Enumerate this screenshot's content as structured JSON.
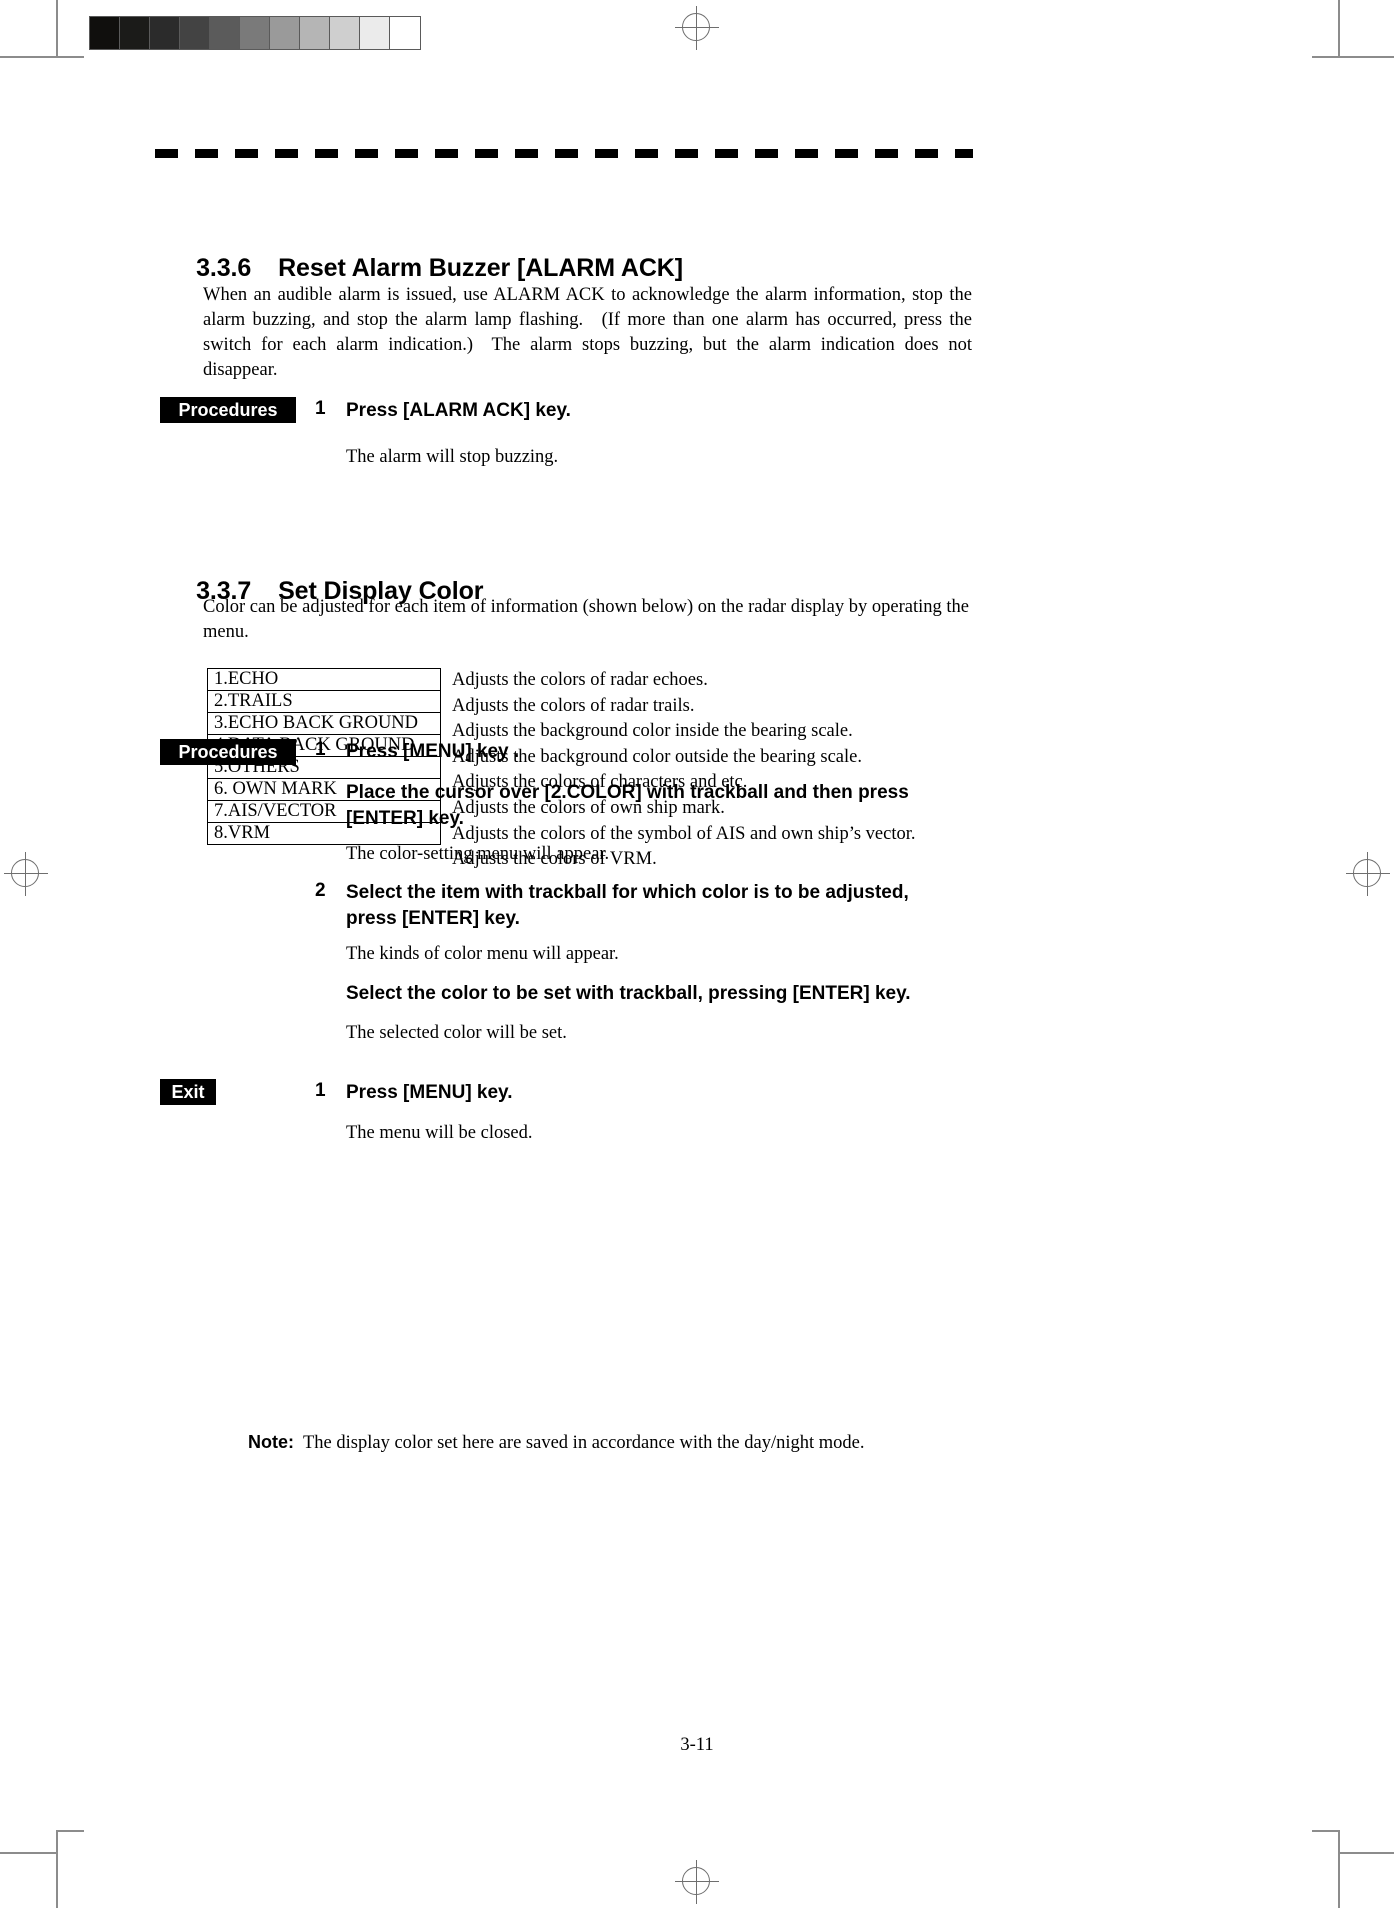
{
  "page": {
    "folio": "3-11"
  },
  "calibration": {
    "swatches": [
      "#100f0d",
      "#1b1b19",
      "#2b2b2b",
      "#434343",
      "#5b5b5b",
      "#7a7a7a",
      "#9a9a9a",
      "#b5b5b5",
      "#cfcfcf",
      "#ebebeb",
      "#ffffff"
    ]
  },
  "sections": {
    "alarm_ack": {
      "number": "3.3.6",
      "title": "Reset Alarm Buzzer [ALARM ACK]",
      "body": "When an audible alarm is issued, use ALARM ACK to acknowledge the alarm information, stop the alarm buzzing, and stop the alarm lamp flashing. (If more than one alarm has occurred, press the switch for each alarm indication.) The alarm stops buzzing, but the alarm indication does not disappear.",
      "procedures_label": "Procedures",
      "step1_num": "1",
      "step1_text": "Press [ALARM ACK] key.",
      "step1_result": "The alarm will stop buzzing."
    },
    "display_color": {
      "number": "3.3.7",
      "title": "Set Display Color",
      "body": "Color can be adjusted for each item of information (shown below) on the radar display by operating the menu.",
      "menu_items": [
        {
          "name": "1.ECHO",
          "description": "Adjusts the colors of radar echoes."
        },
        {
          "name": "2.TRAILS",
          "description": "Adjusts the colors of radar trails."
        },
        {
          "name": "3.ECHO BACK GROUND",
          "description": "Adjusts the background color inside the bearing scale."
        },
        {
          "name": "4.DATA BACK GROUND",
          "description": "Adjusts the background color outside the bearing scale."
        },
        {
          "name": "5.OTHERS",
          "description": "Adjusts the colors of characters and etc."
        },
        {
          "name": "6. OWN MARK",
          "description": "Adjusts the colors of own ship mark."
        },
        {
          "name": "7.AIS/VECTOR",
          "description": "Adjusts the colors of the symbol of AIS and own ship’s vector."
        },
        {
          "name": "8.VRM",
          "description": "Adjusts the colors of VRM."
        }
      ],
      "procedures_label": "Procedures",
      "step1_num": "1",
      "step1_text": "Press [MENU] key .",
      "step1b_text": "Place the cursor over [2.COLOR] with trackball and then press [ENTER] key.",
      "step1_result": "The color-setting menu will appear.",
      "step2_num": "2",
      "step2_text": "Select the item with trackball for which color is to be adjusted, press [ENTER] key.",
      "step2_result": "The kinds of color menu will appear.",
      "step2b_text": "Select the color to be set with trackball, pressing [ENTER] key.",
      "step2b_result": "The selected color will be set.",
      "exit_label": "Exit",
      "exit_step_num": "1",
      "exit_step_text": "Press [MENU] key.",
      "exit_result": "The menu will be closed.",
      "note_label": "Note:",
      "note_text": "The display color set here are saved in accordance with the day/night mode."
    }
  }
}
